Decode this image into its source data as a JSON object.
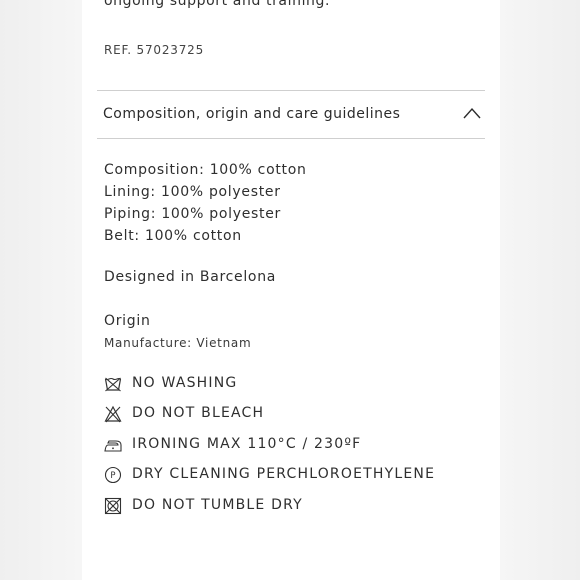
{
  "intro_text": "ongoing support and training.",
  "reference": "REF. 57023725",
  "accordion": {
    "title": "Composition, origin and care guidelines",
    "expanded": true,
    "toggle_icon": "chevron-up-icon"
  },
  "composition": [
    {
      "text": "Composition: 100%  cotton"
    },
    {
      "text": "Lining: 100%  polyester"
    },
    {
      "text": "Piping: 100%  polyester"
    },
    {
      "text": "Belt: 100%  cotton"
    }
  ],
  "designed_in": "Designed in Barcelona",
  "origin": {
    "heading": "Origin",
    "manufacture": "Manufacture: Vietnam"
  },
  "care": [
    {
      "icon": "no-washing-icon",
      "label": "NO WASHING"
    },
    {
      "icon": "do-not-bleach-icon",
      "label": "DO NOT BLEACH"
    },
    {
      "icon": "iron-icon",
      "label": "IRONING MAX 110°C / 230ºF"
    },
    {
      "icon": "dry-clean-p-icon",
      "label": "DRY CLEANING PERCHLOROETHYLENE"
    },
    {
      "icon": "do-not-tumble-dry-icon",
      "label": "DO NOT TUMBLE DRY"
    }
  ],
  "colors": {
    "text": "#2b2b2b",
    "divider": "#cfcfcf",
    "background": "#ffffff",
    "page_margin": "#f1f1f1"
  }
}
